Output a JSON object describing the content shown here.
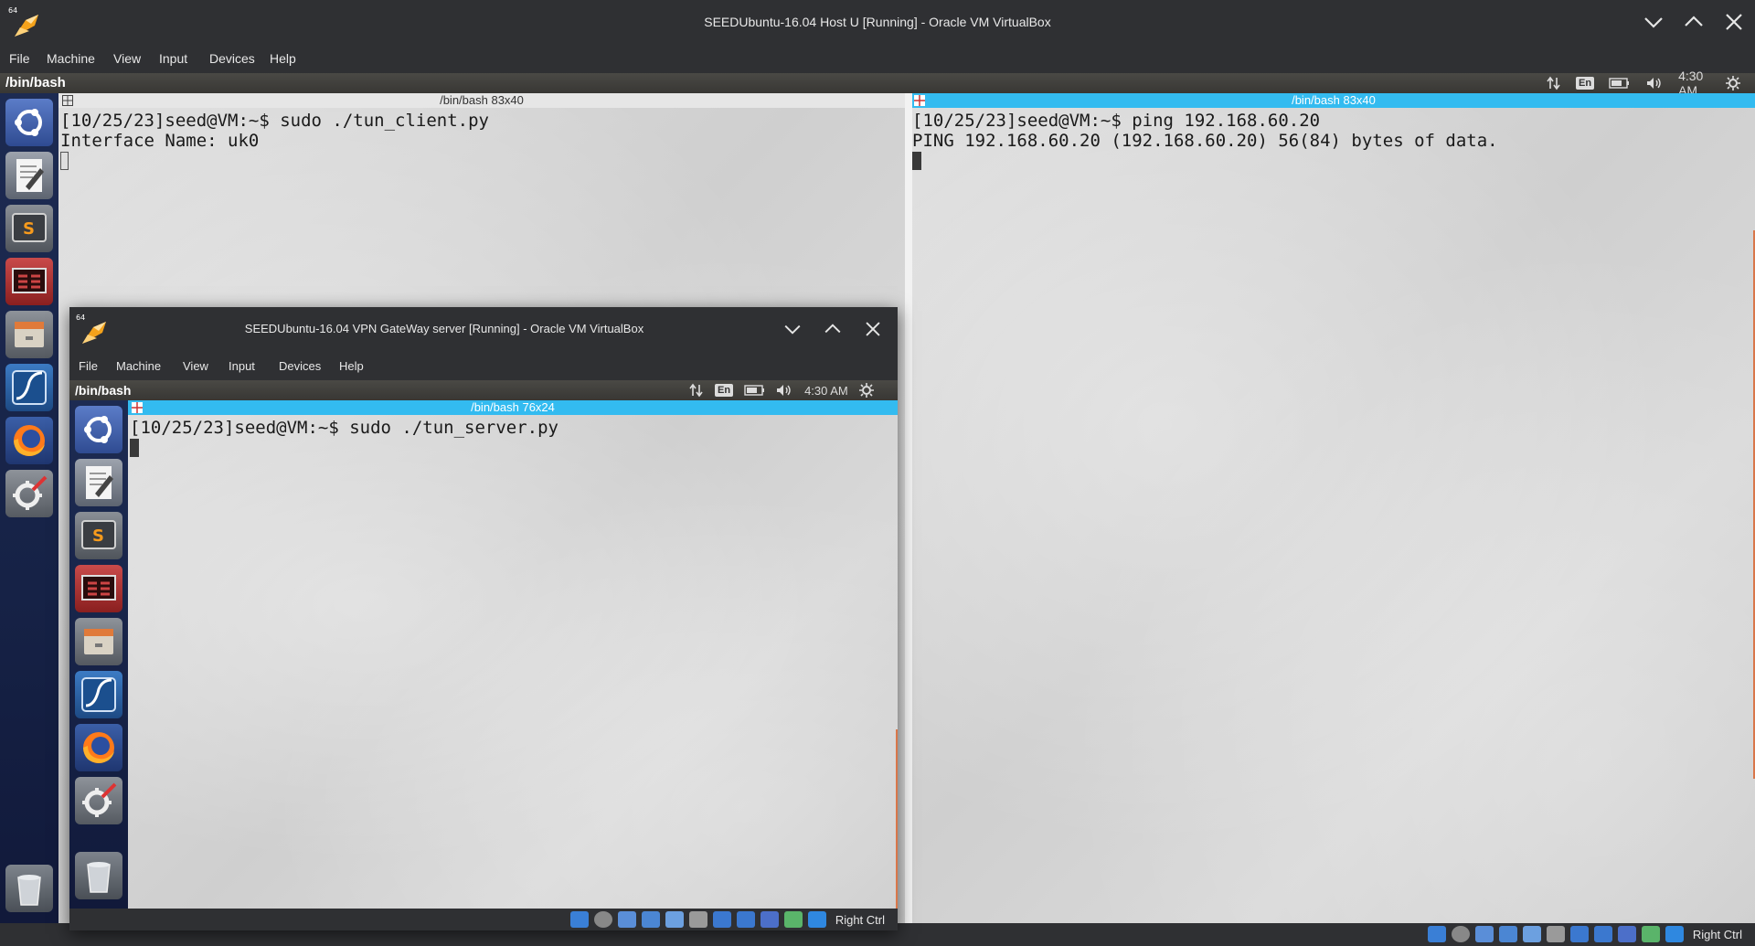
{
  "host": {
    "title": "SEEDUbuntu-16.04 Host U [Running] - Oracle VM VirtualBox",
    "menu": [
      "File",
      "Machine",
      "View",
      "Input",
      "Devices",
      "Help"
    ],
    "panel_title": "/bin/bash",
    "time": "4:30 AM",
    "lang": "En",
    "left_term": {
      "header": "/bin/bash 83x40",
      "lines": [
        "[10/25/23]seed@VM:~$ sudo ./tun_client.py",
        "Interface Name: uk0"
      ]
    },
    "right_term": {
      "header": "/bin/bash 83x40",
      "lines": [
        "[10/25/23]seed@VM:~$ ping 192.168.60.20",
        "PING 192.168.60.20 (192.168.60.20) 56(84) bytes of data."
      ]
    },
    "host_key": "Right Ctrl"
  },
  "gateway": {
    "title": "SEEDUbuntu-16.04 VPN GateWay server [Running] - Oracle VM VirtualBox",
    "menu": [
      "File",
      "Machine",
      "View",
      "Input",
      "Devices",
      "Help"
    ],
    "panel_title": "/bin/bash",
    "time": "4:30 AM",
    "lang": "En",
    "term": {
      "header": "/bin/bash 76x24",
      "lines": [
        "[10/25/23]seed@VM:~$ sudo ./tun_server.py"
      ]
    },
    "host_key": "Right Ctrl"
  },
  "badge": "64",
  "launcher_icons": [
    "ubuntu-dash-icon",
    "text-editor-icon",
    "sublime-text-icon",
    "terminal-icon",
    "file-manager-icon",
    "wireshark-icon",
    "firefox-icon",
    "system-settings-icon",
    "trash-icon"
  ]
}
